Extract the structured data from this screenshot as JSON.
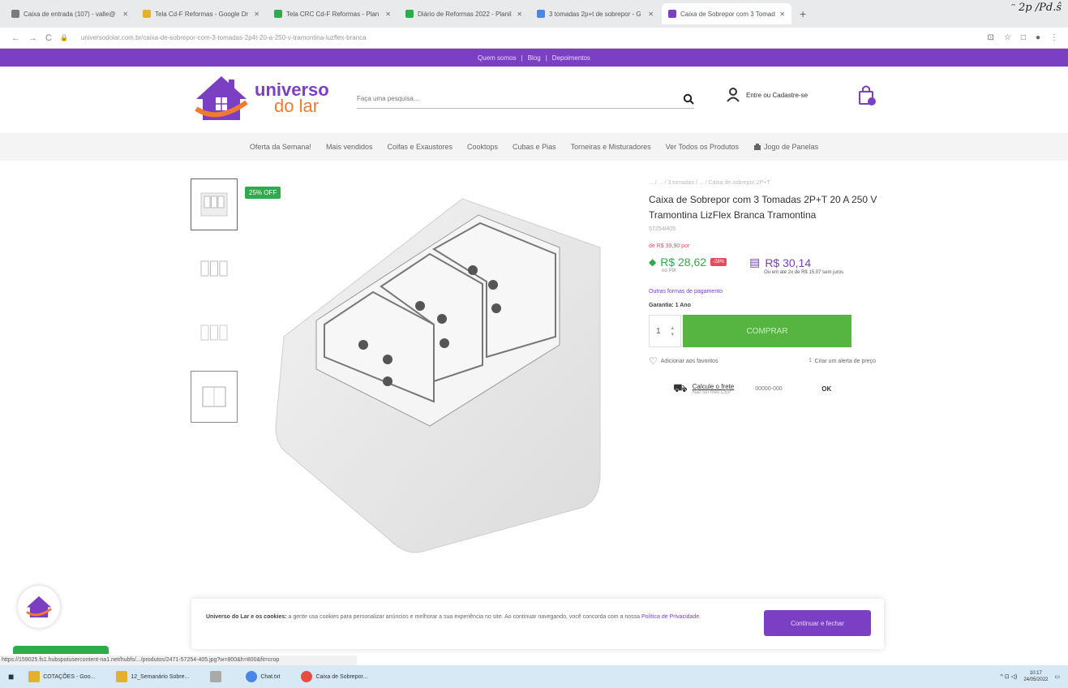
{
  "browser": {
    "tabs": [
      {
        "title": "Caixa de entrada (107) - valle@",
        "color": "#7b7b7b",
        "active": false
      },
      {
        "title": "Tela Cd-F Reformas - Google Dr",
        "color": "#e3b22d",
        "active": false
      },
      {
        "title": "Tela CRC Cd-F Reformas - Plan",
        "color": "#2eab4a",
        "active": false
      },
      {
        "title": "Diário de Reformas 2022 - Planil",
        "color": "#2eab4a",
        "active": false
      },
      {
        "title": "3 tomadas 2p+t de sobrepor - G",
        "color": "#4a86e8",
        "active": false
      },
      {
        "title": "Caixa de Sobrepor com 3 Tomad",
        "color": "#7b3fc4",
        "active": true
      }
    ],
    "new_tab": "+",
    "corner_handwriting": "ᵔ 2p /Pd.ŝ",
    "url": "universodolar.com.br/caixa-de-sobrepor-com-3-tomadas-2p4t-20-a-250-v-tramontina-luzflex-branca",
    "nav_icons": [
      "←",
      "→",
      "C",
      "🔒"
    ],
    "right_icons": [
      "⊡",
      "☆",
      "□",
      "●",
      "⋮"
    ]
  },
  "promo_bar": [
    "Quem somos",
    "|",
    "Blog",
    "|",
    "Depoimentos"
  ],
  "header": {
    "logo_line1": "universo",
    "logo_line2": "do lar",
    "search_placeholder": "Faça uma pesquisa...",
    "search_icon": "search-icon",
    "login_label": "Entre ou Cadastre-se",
    "user_icon": "user-icon",
    "cart_icon": "bag-icon"
  },
  "nav": {
    "items": [
      "Oferta da Semana!",
      "Mais vendidos",
      "Coifas e Exaustores",
      "Cooktops",
      "Cubas e Pias",
      "Torneiras e Misturadores",
      "Ver Todos os Produtos"
    ],
    "special": "Jogo de Panelas",
    "special_icon": "cookware-icon"
  },
  "product": {
    "badge": "25% OFF",
    "breadcrumb": "... / ... / 3 tomadas / ... / Caixa de sobrepor 2P+T",
    "title": "Caixa de Sobrepor com 3 Tomadas 2P+T 20 A 250 V Tramontina LizFlex Branca Tramontina",
    "sku": "57254/405",
    "old_price": "de R$ 39,90 por",
    "pix_price": "R$ 28,62",
    "pix_tag": "-28%",
    "pix_sub": "no PIX",
    "card_price": "R$ 30,14",
    "card_installments": "Ou em até 2x de R$ 15,07 sem juros",
    "other_payments": "Outras formas de pagamento",
    "warranty": "Garantia: 1 Ano",
    "qty": "1",
    "buy_label": "COMPRAR",
    "favorite_label": "Adicionar aos favoritos",
    "price_alert_label": "Criar um alerta de preço",
    "shipping_title": "Calcule o frete",
    "shipping_sub": "Não sei meu CEP",
    "cep_placeholder": "00000-000",
    "ok_label": "OK",
    "colors": {
      "accent": "#7b3fc4",
      "green": "#2eab4a",
      "red": "#e74c5c"
    }
  },
  "cookie": {
    "brand": "Universo do Lar e os cookies:",
    "text": "a gente usa cookies para personalizar anúncios e melhorar a sua experiência no site. Ao continuar navegando, você concorda com a nossa",
    "policy_link": "Política de Privacidade.",
    "button": "Continuar e fechar"
  },
  "status_url": "https://159025.fs1.hubspotusercontent-na1.net/hubfs/.../produtos/2471-57254-405.jpg?w=800&h=800&fit=crop",
  "taskbar": {
    "items": [
      "COTAÇÕES - Goo...",
      "12_Semanário Sobre...",
      "",
      "Chat.txt",
      "Caixa de Sobrepor..."
    ],
    "time": "10:17",
    "date": "24/05/2022",
    "tray": "^ ⊡ ◁)"
  }
}
